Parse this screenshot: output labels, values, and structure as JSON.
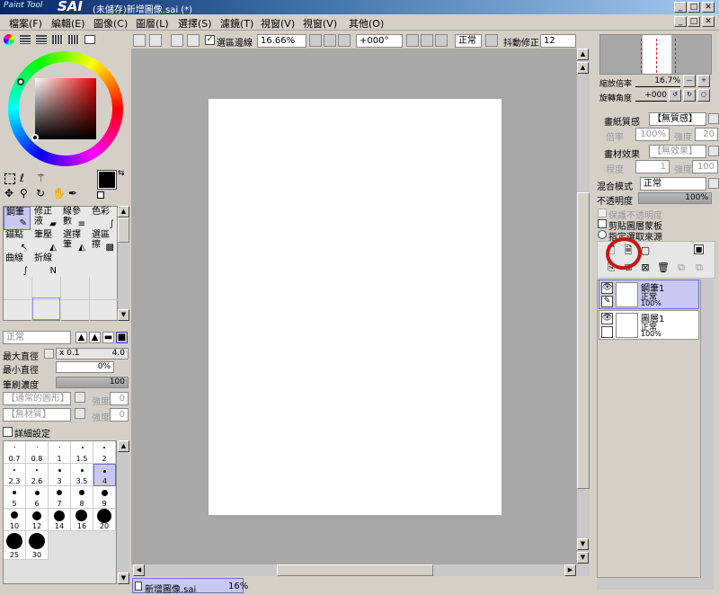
{
  "app": {
    "logo": "Paint Tool",
    "name": "SAI",
    "title": "(未儲存)新增圖像.sai (*)"
  },
  "window_buttons": {
    "min": "_",
    "max": "□",
    "close": "✕"
  },
  "menu": [
    "檔案(F)",
    "編輯(E)",
    "圖像(C)",
    "圖層(L)",
    "選擇(S)",
    "濾鏡(T)",
    "視窗(V)",
    "視窗(V)",
    "其他(O)"
  ],
  "toolbar": {
    "selection_border_label": "選區邊線",
    "zoom": "16.66%",
    "rotation": "+000°",
    "mode": "正常",
    "stabilizer_label": "抖動修正",
    "stabilizer_value": "12"
  },
  "navigator": {
    "zoom_label": "縮放倍率",
    "zoom_value": "16.7%",
    "rotate_label": "旋轉角度",
    "rotate_value": "+000"
  },
  "layer_props": {
    "paper_texture_label": "畫紙質感",
    "paper_texture_value": "【無質感】",
    "texture_rate_label": "倍率",
    "texture_rate_value": "100%",
    "texture_strength_label": "強度",
    "texture_strength_value": "20",
    "paint_effect_label": "畫材效果",
    "paint_effect_value": "【無效果】",
    "effect_degree_label": "程度",
    "effect_degree_value": "1",
    "effect_strength_label": "強度",
    "effect_strength_value": "100",
    "blend_label": "混合模式",
    "blend_value": "正常",
    "opacity_label": "不透明度",
    "opacity_value": "100%",
    "preserve_opacity": "保護不透明度",
    "clipping": "剪貼圖層蒙板",
    "selection_source": "指定選取來源"
  },
  "layers": [
    {
      "name": "鋼筆1",
      "mode": "正常",
      "opacity": "100%",
      "selected": true
    },
    {
      "name": "圖層1",
      "mode": "正常",
      "opacity": "100%",
      "selected": false
    }
  ],
  "tools": [
    {
      "label": "鋼筆",
      "icon": "✎"
    },
    {
      "label": "修正液",
      "icon": "▰"
    },
    {
      "label": "線參數",
      "icon": "≡"
    },
    {
      "label": "色彩",
      "icon": "∫"
    },
    {
      "label": "錨點",
      "icon": "↖"
    },
    {
      "label": "筆壓",
      "icon": "◭"
    },
    {
      "label": "選擇筆",
      "icon": "◭"
    },
    {
      "label": "選區擦",
      "icon": "▩"
    },
    {
      "label": "曲線",
      "icon": "∫"
    },
    {
      "label": "折線",
      "icon": "N"
    }
  ],
  "brush": {
    "mode": "正常",
    "max_size_label": "最大直徑",
    "max_size_mult": "x 0.1",
    "max_size_value": "4.0",
    "min_size_label": "最小直徑",
    "min_size_value": "0%",
    "density_label": "筆刷濃度",
    "density_value": "100",
    "shape_placeholder": "【通常的圓形】",
    "shape_strength_label": "強度",
    "shape_strength_value": "0",
    "texture_placeholder": "【無材質】",
    "texture_strength_label": "強度",
    "texture_strength_value": "0",
    "detail_label": "詳細設定"
  },
  "brush_sizes": [
    "0.7",
    "0.8",
    "1",
    "1.5",
    "2",
    "2.3",
    "2.6",
    "3",
    "3.5",
    "4",
    "5",
    "6",
    "7",
    "8",
    "9",
    "10",
    "12",
    "14",
    "16",
    "20",
    "25",
    "30"
  ],
  "status": {
    "doc_name": "新增圖像.sai",
    "zoom": "16%"
  },
  "colors": {
    "accent_select": "#c8c8f0",
    "canvas_bg": "#a8a8a8",
    "primary": "#000000",
    "secondary": "#4a2a8a",
    "highlight_circle": "#c81414"
  }
}
